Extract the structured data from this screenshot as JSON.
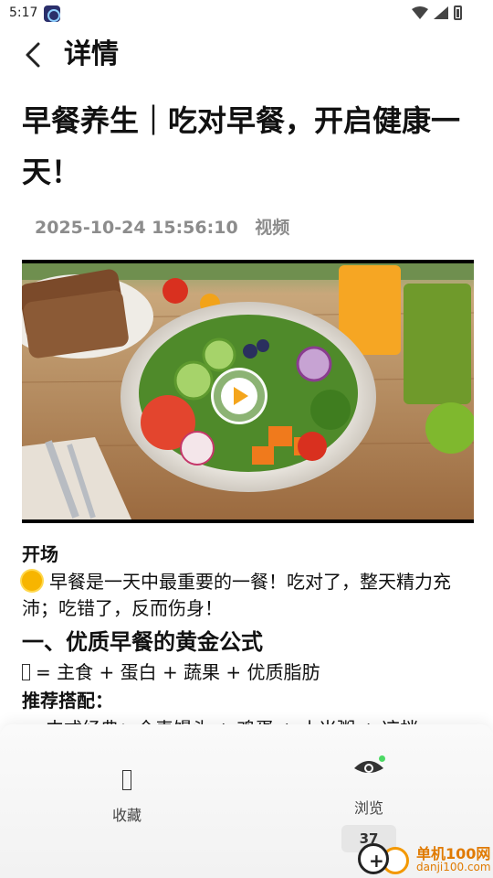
{
  "status_bar": {
    "time": "5:17"
  },
  "header": {
    "title": "详情"
  },
  "article": {
    "title": "早餐养生｜吃对早餐，开启健康一天！",
    "date": "2025-10-24 15:56:10",
    "type": "视频"
  },
  "content": {
    "opening_label": "开场",
    "intro_text": "早餐是一天中最重要的一餐！吃对了，整天精力充沛；吃错了，反而伤身！",
    "section1_title": "一、优质早餐的黄金公式",
    "formula": "= 主食 + 蛋白 + 蔬果 + 优质脂肪",
    "recommend_label": "推荐搭配：",
    "bullets": [
      "中式经典：全麦馒头 + 鸡蛋 + 小米粥 + 凉拌"
    ]
  },
  "bottom_bar": {
    "collect_label": "收藏",
    "browse_label": "浏览",
    "view_count": "37"
  },
  "watermark": {
    "name": "单机100网",
    "url": "danji100.com"
  },
  "colors": {
    "accent_orange": "#f4a51c",
    "meta_gray": "#8c8c8c",
    "online_dot": "#4cd964"
  },
  "icons": [
    "app-icon",
    "wifi-icon",
    "signal-icon",
    "battery-icon",
    "back-arrow-icon",
    "play-icon",
    "sun-emoji-icon",
    "collect-icon",
    "eye-icon"
  ]
}
